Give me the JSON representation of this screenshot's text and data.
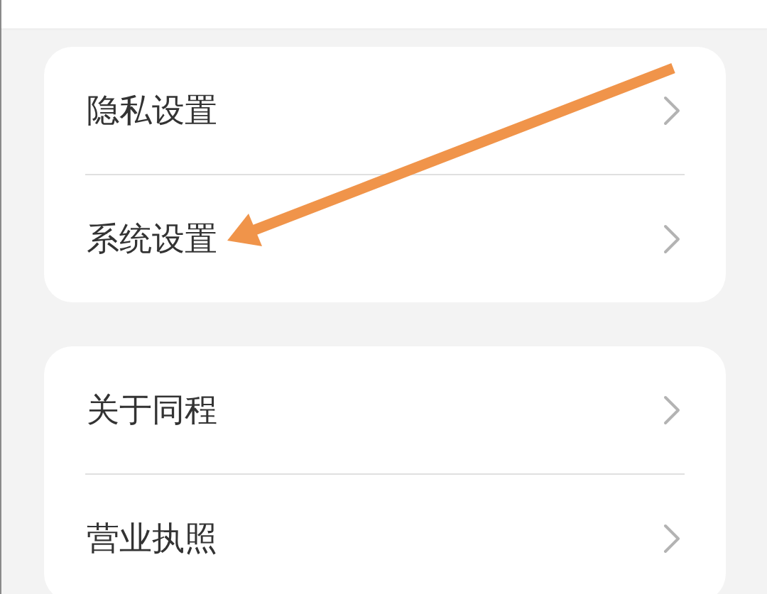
{
  "groups": [
    {
      "items": [
        {
          "label": "隐私设置"
        },
        {
          "label": "系统设置"
        }
      ]
    },
    {
      "items": [
        {
          "label": "关于同程"
        },
        {
          "label": "营业执照"
        }
      ]
    }
  ]
}
